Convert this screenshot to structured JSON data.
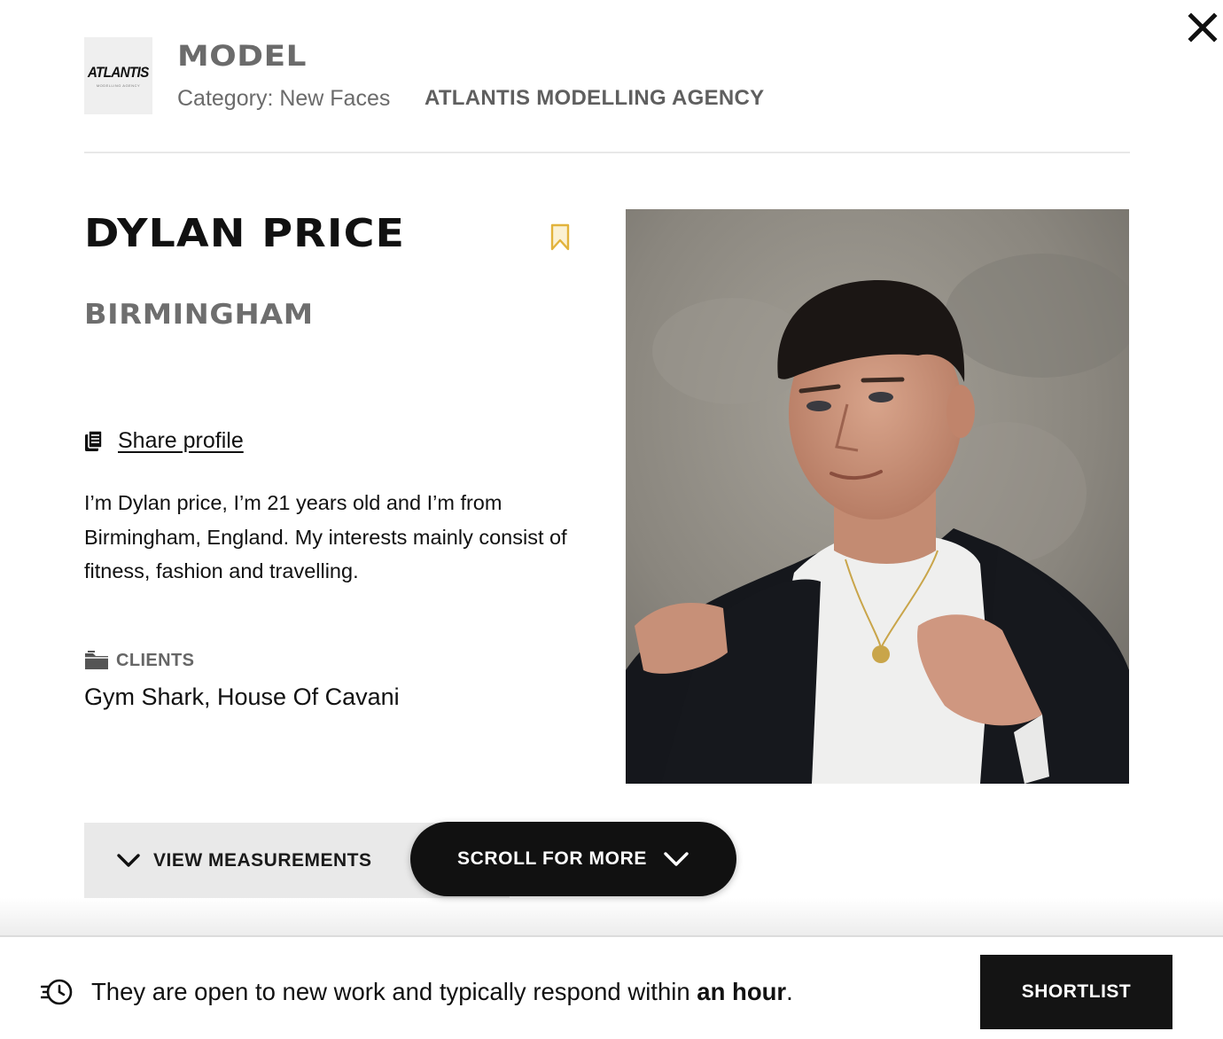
{
  "header": {
    "logo_text": "ATLANTIS",
    "logo_subtext": "MODELLING AGENCY",
    "type_title": "MODEL",
    "category_text": "Category: New Faces",
    "agency_name": "ATLANTIS MODELLING AGENCY"
  },
  "profile": {
    "name": "DYLAN PRICE",
    "city": "BIRMINGHAM",
    "share_label": "Share profile",
    "bio": "I’m Dylan price, I’m 21 years old and I’m from Birmingham, England. My interests mainly consist of fitness, fashion and travelling.",
    "clients_label": "CLIENTS",
    "clients_value": "Gym Shark, House Of Cavani"
  },
  "actions": {
    "view_measurements_label": "VIEW MEASUREMENTS",
    "scroll_for_more_label": "SCROLL FOR MORE",
    "shortlist_label": "SHORTLIST"
  },
  "footer": {
    "response_text_prefix": "They are open to new work and typically respond within ",
    "response_text_emphasis": "an hour",
    "response_text_suffix": "."
  },
  "icons": {
    "close": "close-icon",
    "bookmark": "bookmark-icon",
    "share": "share-icon",
    "clients": "folder-icon",
    "measurements_chevron": "chevron-down-icon",
    "scroll_chevron": "chevron-down-icon",
    "response": "fast-response-icon"
  },
  "colors": {
    "bookmark_accent": "#e2b33c",
    "dark_button": "#141414",
    "muted_text": "#6b6b6b",
    "measure_bar_bg": "#e9e9e9"
  }
}
